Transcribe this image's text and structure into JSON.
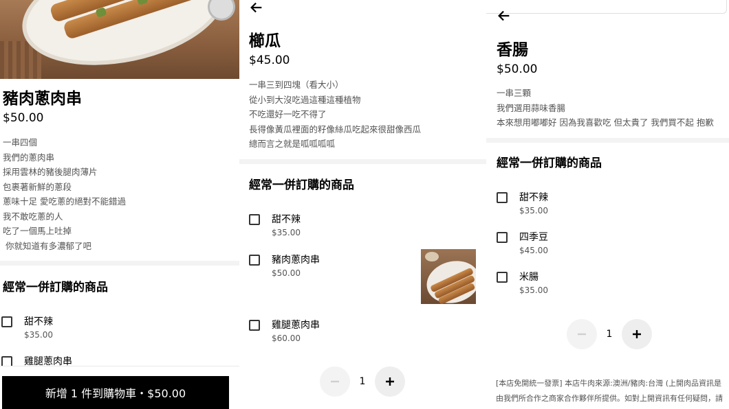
{
  "panel1": {
    "title": "豬肉蔥肉串",
    "price": "$50.00",
    "description": [
      "一串四個",
      "我們的蔥肉串",
      "採用雲林的豬後腿肉薄片",
      "包裹著新鮮的蔥段",
      "蔥味十足 愛吃蔥的絕對不能錯過",
      "我不敢吃蔥的人",
      "吃了一個馬上吐掉",
      " 你就知道有多濃郁了吧"
    ],
    "section_title": "經常一併訂購的商品",
    "options": [
      {
        "name": "甜不辣",
        "price": "$35.00"
      },
      {
        "name": "雞腿蔥肉串",
        "price": ""
      }
    ],
    "cart_button": "新增 1 件到購物車・$50.00"
  },
  "panel2": {
    "title": "櫛瓜",
    "price": "$45.00",
    "description": [
      "一串三到四塊（看大小）",
      "從小到大沒吃過這種這種植物",
      "不吃還好一吃不得了",
      "長得像黃瓜裡面的籽像絲瓜吃起來很甜像西瓜",
      "總而言之就是呱呱呱呱"
    ],
    "section_title": "經常一併訂購的商品",
    "options": [
      {
        "name": "甜不辣",
        "price": "$35.00"
      },
      {
        "name": "豬肉蔥肉串",
        "price": "$50.00"
      },
      {
        "name": "雞腿蔥肉串",
        "price": "$60.00"
      }
    ],
    "quantity": "1"
  },
  "panel3": {
    "title": "香腸",
    "price": "$50.00",
    "description": [
      "一串三顆",
      "我們選用蒜味香腸",
      "本來想用嘟嘟好 因為我喜歡吃 但太貴了 我們買不起 抱歉"
    ],
    "section_title": "經常一併訂購的商品",
    "options": [
      {
        "name": "甜不辣",
        "price": "$35.00"
      },
      {
        "name": "四季豆",
        "price": "$45.00"
      },
      {
        "name": "米腸",
        "price": "$35.00"
      }
    ],
    "quantity": "1",
    "footer_note": [
      "[本店免開統一發票] 本店牛肉來源:澳洲/豬肉:台灣 (上開肉品資訊是",
      "由我們所合作之商家合作夥伴所提供。如對上開資訊有任何疑問，請"
    ]
  },
  "colors": {
    "button_bg": "#000000",
    "stepper_bg": "#eeeeee",
    "divider": "#f3f3f3",
    "secondary_text": "#545454"
  },
  "icons": {
    "back": "arrow-left-icon",
    "minus": "minus-icon",
    "plus": "plus-icon"
  }
}
